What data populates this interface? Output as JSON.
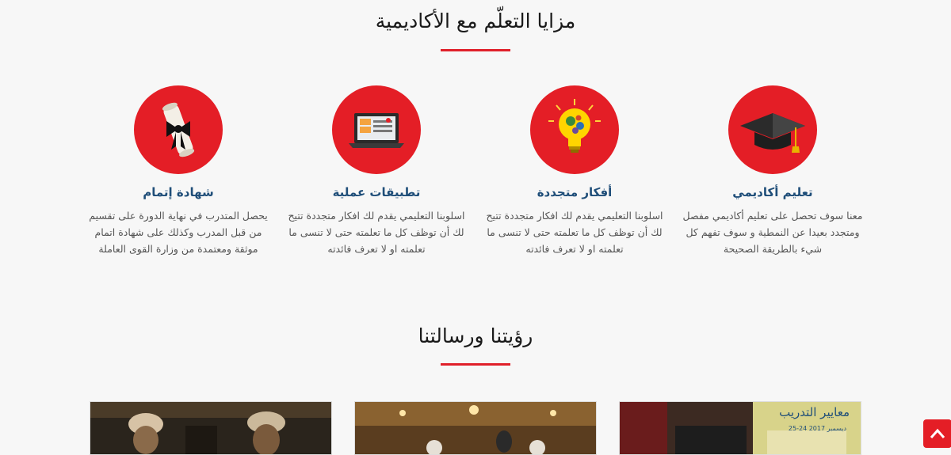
{
  "features_section": {
    "title": "مزايا التعلّم مع الأكاديمية"
  },
  "features": [
    {
      "icon": "graduation-cap-icon",
      "title": "تعليم أكاديمي",
      "description": "معنا سوف تحصل على تعليم أكاديمي مفصل ومتجدد بعيدا عن النمطية و سوف تفهم كل شيء بالطريقة الصحيحة"
    },
    {
      "icon": "lightbulb-gears-icon",
      "title": "أفكار متجددة",
      "description": "اسلوبنا التعليمي يقدم لك افكار متجددة تتيح لك أن توظف كل ما تعلمته حتى لا تنسى ما تعلمته او لا تعرف فائدته"
    },
    {
      "icon": "laptop-icon",
      "title": "تطبيقات عملية",
      "description": "اسلوبنا التعليمي يقدم لك افكار متجددة تتيح لك أن توظف كل ما تعلمته حتى لا تنسى ما تعلمته او لا تعرف فائدته"
    },
    {
      "icon": "diploma-scroll-icon",
      "title": "شهادة إتمام",
      "description": "يحصل المتدرب في نهاية الدورة على تقسيم من قبل المدرب وكذلك على شهادة اتمام موثقة ومعتمدة من وزارة القوى العاملة"
    }
  ],
  "vision_section": {
    "title": "رؤيتنا ورسالتنا"
  },
  "photos": [
    {
      "alt": "photo-men-in-traditional-dress"
    },
    {
      "alt": "photo-conference-hall"
    },
    {
      "alt": "photo-training-event-banner",
      "banner_text": "معايير التدريب",
      "banner_date": "25-24 ديسمبر 2017"
    }
  ],
  "colors": {
    "accent": "#e41e26",
    "title_blue": "#1f4e79",
    "text_gray": "#555555",
    "background": "#f7f7f7"
  }
}
